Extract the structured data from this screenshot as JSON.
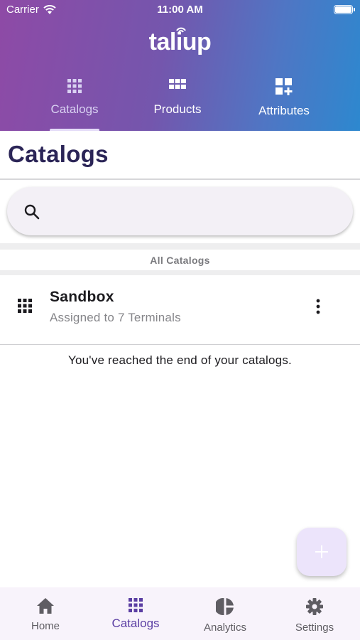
{
  "status_bar": {
    "carrier": "Carrier",
    "time": "11:00 AM"
  },
  "app": {
    "logo": "taliup"
  },
  "top_tabs": [
    {
      "label": "Catalogs",
      "icon": "catalog-grid-icon",
      "active": true
    },
    {
      "label": "Products",
      "icon": "products-grid-icon",
      "active": false
    },
    {
      "label": "Attributes",
      "icon": "attributes-add-icon",
      "active": false
    }
  ],
  "page": {
    "title": "Catalogs"
  },
  "search": {
    "placeholder": "",
    "value": ""
  },
  "section": {
    "label": "All Catalogs"
  },
  "catalogs": [
    {
      "name": "Sandbox",
      "subtitle": "Assigned to 7 Terminals",
      "icon": "catalog-grid-icon"
    }
  ],
  "list_end": {
    "text": "You've reached the end of your catalogs."
  },
  "fab": {
    "icon": "plus-icon"
  },
  "bottom_nav": [
    {
      "label": "Home",
      "icon": "home-icon",
      "active": false
    },
    {
      "label": "Catalogs",
      "icon": "catalog-grid-icon",
      "active": true
    },
    {
      "label": "Analytics",
      "icon": "pie-chart-icon",
      "active": false
    },
    {
      "label": "Settings",
      "icon": "gear-icon",
      "active": false
    }
  ],
  "colors": {
    "header_gradient_start": "#8e4aa6",
    "header_gradient_end": "#2d88cf",
    "title": "#2b2557",
    "accent": "#5b3ea3"
  }
}
